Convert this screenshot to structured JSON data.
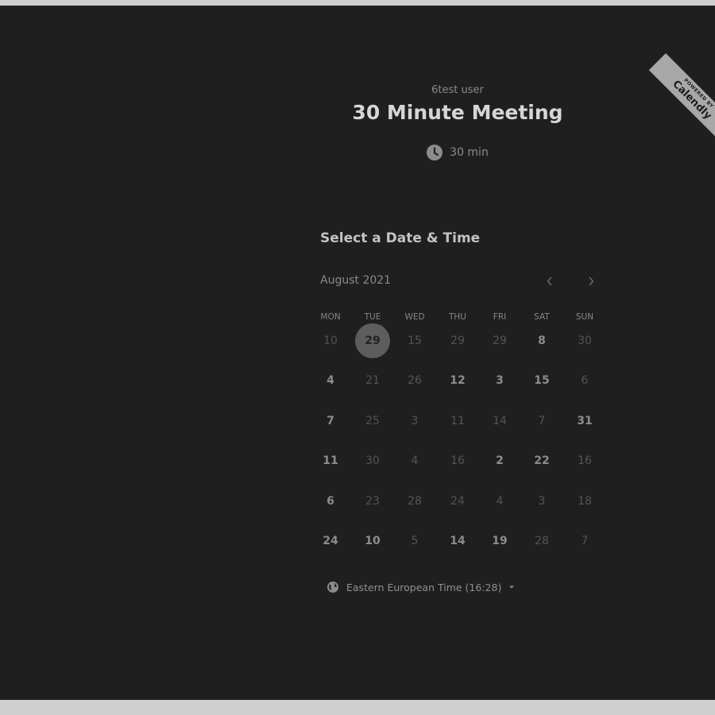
{
  "header": {
    "host_name": "6test user",
    "event_title": "30 Minute Meeting",
    "duration_label": "30 min",
    "duration_icon": "clock-icon"
  },
  "ribbon": {
    "small_text": "POWERED BY",
    "brand_text": "Calendly"
  },
  "calendar": {
    "heading": "Select a Date & Time",
    "month_label": "August 2021",
    "prev_icon": "chevron-left-icon",
    "next_icon": "chevron-right-icon",
    "weekdays": [
      "MON",
      "TUE",
      "WED",
      "THU",
      "FRI",
      "SAT",
      "SUN"
    ],
    "weeks": [
      [
        {
          "label": "10",
          "state": "inactive"
        },
        {
          "label": "29",
          "state": "selected"
        },
        {
          "label": "15",
          "state": "inactive"
        },
        {
          "label": "29",
          "state": "inactive"
        },
        {
          "label": "29",
          "state": "inactive"
        },
        {
          "label": "8",
          "state": "available"
        },
        {
          "label": "30",
          "state": "inactive"
        }
      ],
      [
        {
          "label": "4",
          "state": "available"
        },
        {
          "label": "21",
          "state": "inactive"
        },
        {
          "label": "26",
          "state": "inactive"
        },
        {
          "label": "12",
          "state": "available"
        },
        {
          "label": "3",
          "state": "available"
        },
        {
          "label": "15",
          "state": "available"
        },
        {
          "label": "6",
          "state": "inactive"
        }
      ],
      [
        {
          "label": "7",
          "state": "available"
        },
        {
          "label": "25",
          "state": "inactive"
        },
        {
          "label": "3",
          "state": "inactive"
        },
        {
          "label": "11",
          "state": "inactive"
        },
        {
          "label": "14",
          "state": "inactive"
        },
        {
          "label": "7",
          "state": "inactive"
        },
        {
          "label": "31",
          "state": "available"
        }
      ],
      [
        {
          "label": "11",
          "state": "available"
        },
        {
          "label": "30",
          "state": "inactive"
        },
        {
          "label": "4",
          "state": "inactive"
        },
        {
          "label": "16",
          "state": "inactive"
        },
        {
          "label": "2",
          "state": "available"
        },
        {
          "label": "22",
          "state": "available"
        },
        {
          "label": "16",
          "state": "inactive"
        }
      ],
      [
        {
          "label": "6",
          "state": "available"
        },
        {
          "label": "23",
          "state": "inactive"
        },
        {
          "label": "28",
          "state": "inactive"
        },
        {
          "label": "24",
          "state": "inactive"
        },
        {
          "label": "4",
          "state": "inactive"
        },
        {
          "label": "3",
          "state": "inactive"
        },
        {
          "label": "18",
          "state": "inactive"
        }
      ],
      [
        {
          "label": "24",
          "state": "available"
        },
        {
          "label": "10",
          "state": "available"
        },
        {
          "label": "5",
          "state": "inactive"
        },
        {
          "label": "14",
          "state": "available"
        },
        {
          "label": "19",
          "state": "available"
        },
        {
          "label": "28",
          "state": "inactive"
        },
        {
          "label": "7",
          "state": "inactive"
        }
      ]
    ]
  },
  "timezone": {
    "label": "Eastern European Time (16:28)",
    "icon": "globe-icon",
    "caret_icon": "caret-down-icon"
  },
  "colors": {
    "panel_background": "#1f1f1f",
    "page_background": "#cfcfcf",
    "selected_day": "#5d5d5d",
    "ribbon": "#a8a8a8"
  }
}
